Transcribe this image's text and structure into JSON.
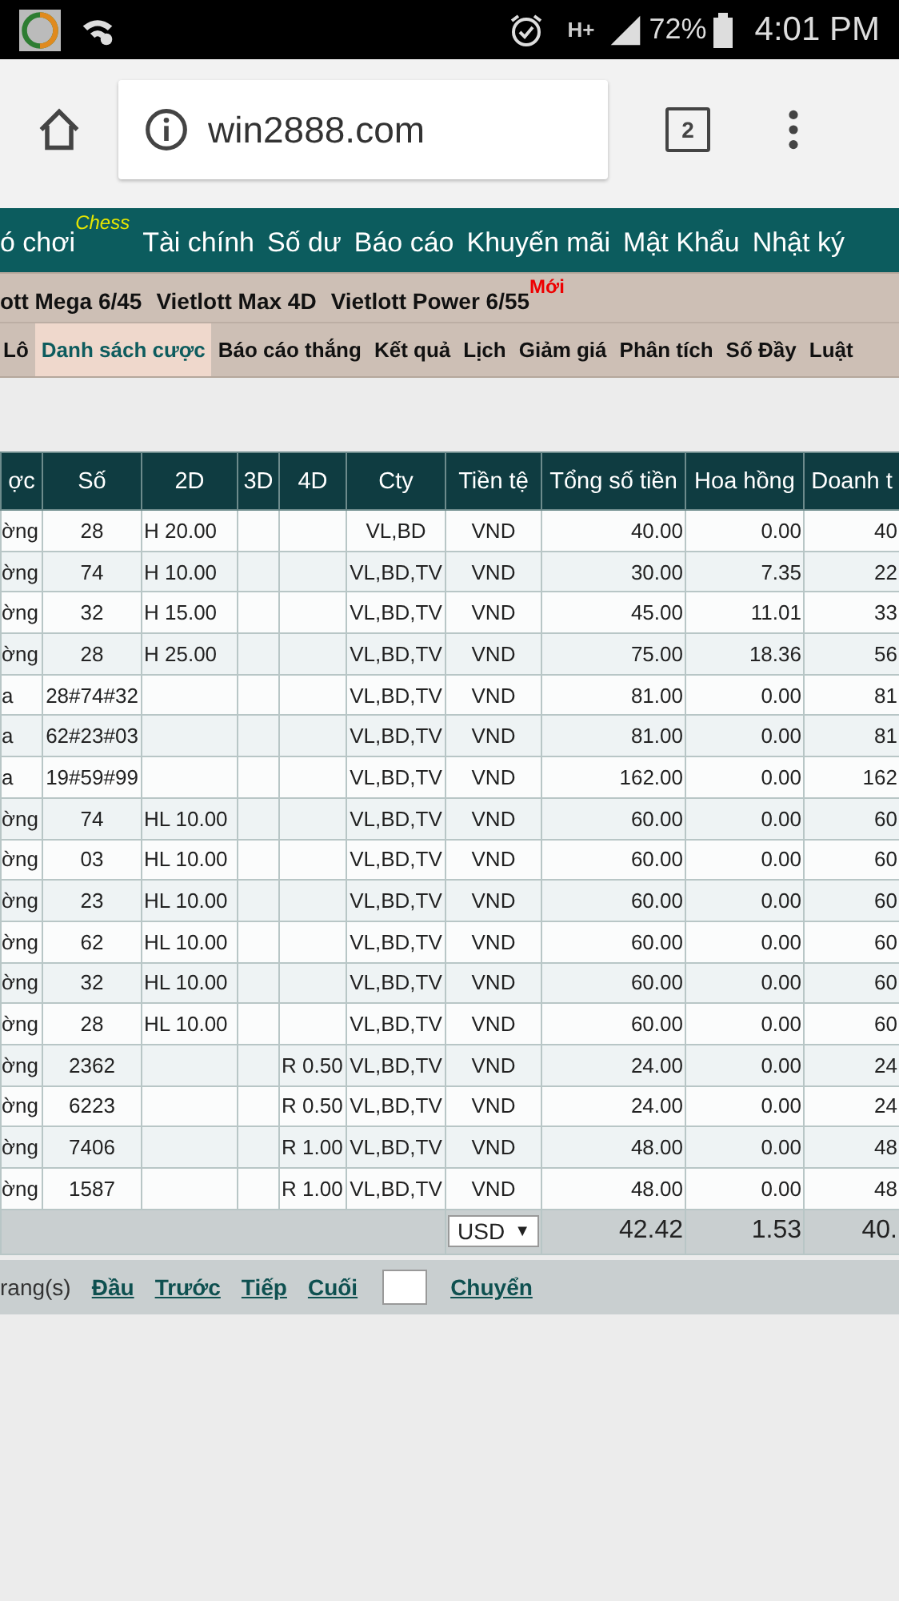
{
  "status_bar": {
    "network": "H+",
    "battery": "72%",
    "time": "4:01 PM"
  },
  "browser": {
    "url": "win2888.com",
    "tab_count": "2"
  },
  "main_nav": [
    {
      "label": "ó chơi",
      "badge": "Chess"
    },
    {
      "label": "Tài chính"
    },
    {
      "label": "Số dư"
    },
    {
      "label": "Báo cáo"
    },
    {
      "label": "Khuyến mãi"
    },
    {
      "label": "Mật Khẩu"
    },
    {
      "label": "Nhật ký"
    }
  ],
  "game_nav": [
    {
      "label": "ott Mega 6/45"
    },
    {
      "label": "Vietlott Max 4D"
    },
    {
      "label": "Vietlott Power 6/55",
      "badge": "Mới"
    }
  ],
  "tabs": [
    {
      "label": "Lô",
      "selected": false
    },
    {
      "label": "Danh sách cược",
      "selected": true
    },
    {
      "label": "Báo cáo thắng",
      "selected": false
    },
    {
      "label": "Kết quả",
      "selected": false
    },
    {
      "label": "Lịch",
      "selected": false
    },
    {
      "label": "Giảm giá",
      "selected": false
    },
    {
      "label": "Phân tích",
      "selected": false
    },
    {
      "label": "Số Đầy",
      "selected": false
    },
    {
      "label": "Luật",
      "selected": false
    }
  ],
  "table": {
    "columns": [
      "ợc",
      "Số",
      "2D",
      "3D",
      "4D",
      "Cty",
      "Tiền tệ",
      "Tổng số tiền",
      "Hoa hồng",
      "Doanh t"
    ],
    "rows": [
      {
        "column_1": "ờng",
        "so": "28",
        "d2": "H 20.00",
        "cty": "VL,BD",
        "currency": "VND",
        "total": "40.00",
        "commission": "0.00",
        "revenue": "40"
      },
      {
        "column_1": "ờng",
        "so": "74",
        "d2": "H 10.00",
        "cty": "VL,BD,TV",
        "currency": "VND",
        "total": "30.00",
        "commission": "7.35",
        "revenue": "22"
      },
      {
        "column_1": "ờng",
        "so": "32",
        "d2": "H 15.00",
        "cty": "VL,BD,TV",
        "currency": "VND",
        "total": "45.00",
        "commission": "11.01",
        "revenue": "33"
      },
      {
        "column_1": "ờng",
        "so": "28",
        "d2": "H 25.00",
        "cty": "VL,BD,TV",
        "currency": "VND",
        "total": "75.00",
        "commission": "18.36",
        "revenue": "56"
      },
      {
        "column_1": "a",
        "so": "28#74#32",
        "cty": "VL,BD,TV",
        "currency": "VND",
        "total": "81.00",
        "commission": "0.00",
        "revenue": "81"
      },
      {
        "column_1": "a",
        "so": "62#23#03",
        "cty": "VL,BD,TV",
        "currency": "VND",
        "total": "81.00",
        "commission": "0.00",
        "revenue": "81"
      },
      {
        "column_1": "a",
        "so": "19#59#99",
        "cty": "VL,BD,TV",
        "currency": "VND",
        "total": "162.00",
        "commission": "0.00",
        "revenue": "162"
      },
      {
        "column_1": "ờng",
        "so": "74",
        "d2": "HL 10.00",
        "cty": "VL,BD,TV",
        "currency": "VND",
        "total": "60.00",
        "commission": "0.00",
        "revenue": "60"
      },
      {
        "column_1": "ờng",
        "so": "03",
        "d2": "HL 10.00",
        "cty": "VL,BD,TV",
        "currency": "VND",
        "total": "60.00",
        "commission": "0.00",
        "revenue": "60"
      },
      {
        "column_1": "ờng",
        "so": "23",
        "d2": "HL 10.00",
        "cty": "VL,BD,TV",
        "currency": "VND",
        "total": "60.00",
        "commission": "0.00",
        "revenue": "60"
      },
      {
        "column_1": "ờng",
        "so": "62",
        "d2": "HL 10.00",
        "cty": "VL,BD,TV",
        "currency": "VND",
        "total": "60.00",
        "commission": "0.00",
        "revenue": "60"
      },
      {
        "column_1": "ờng",
        "so": "32",
        "d2": "HL 10.00",
        "cty": "VL,BD,TV",
        "currency": "VND",
        "total": "60.00",
        "commission": "0.00",
        "revenue": "60"
      },
      {
        "column_1": "ờng",
        "so": "28",
        "d2": "HL 10.00",
        "cty": "VL,BD,TV",
        "currency": "VND",
        "total": "60.00",
        "commission": "0.00",
        "revenue": "60"
      },
      {
        "column_1": "ờng",
        "so": "2362",
        "d4": "R 0.50",
        "cty": "VL,BD,TV",
        "currency": "VND",
        "total": "24.00",
        "commission": "0.00",
        "revenue": "24"
      },
      {
        "column_1": "ờng",
        "so": "6223",
        "d4": "R 0.50",
        "cty": "VL,BD,TV",
        "currency": "VND",
        "total": "24.00",
        "commission": "0.00",
        "revenue": "24"
      },
      {
        "column_1": "ờng",
        "so": "7406",
        "d4": "R 1.00",
        "cty": "VL,BD,TV",
        "currency": "VND",
        "total": "48.00",
        "commission": "0.00",
        "revenue": "48"
      },
      {
        "column_1": "ờng",
        "so": "1587",
        "d4": "R 1.00",
        "cty": "VL,BD,TV",
        "currency": "VND",
        "total": "48.00",
        "commission": "0.00",
        "revenue": "48"
      }
    ],
    "totals": {
      "currency": "USD",
      "caret": "▼",
      "total": "42.42",
      "commission": "1.53",
      "revenue": "40."
    }
  },
  "pagination": {
    "label": "rang(s)",
    "links": [
      "Đầu",
      "Trước",
      "Tiếp",
      "Cuối"
    ],
    "go": "Chuyển"
  }
}
